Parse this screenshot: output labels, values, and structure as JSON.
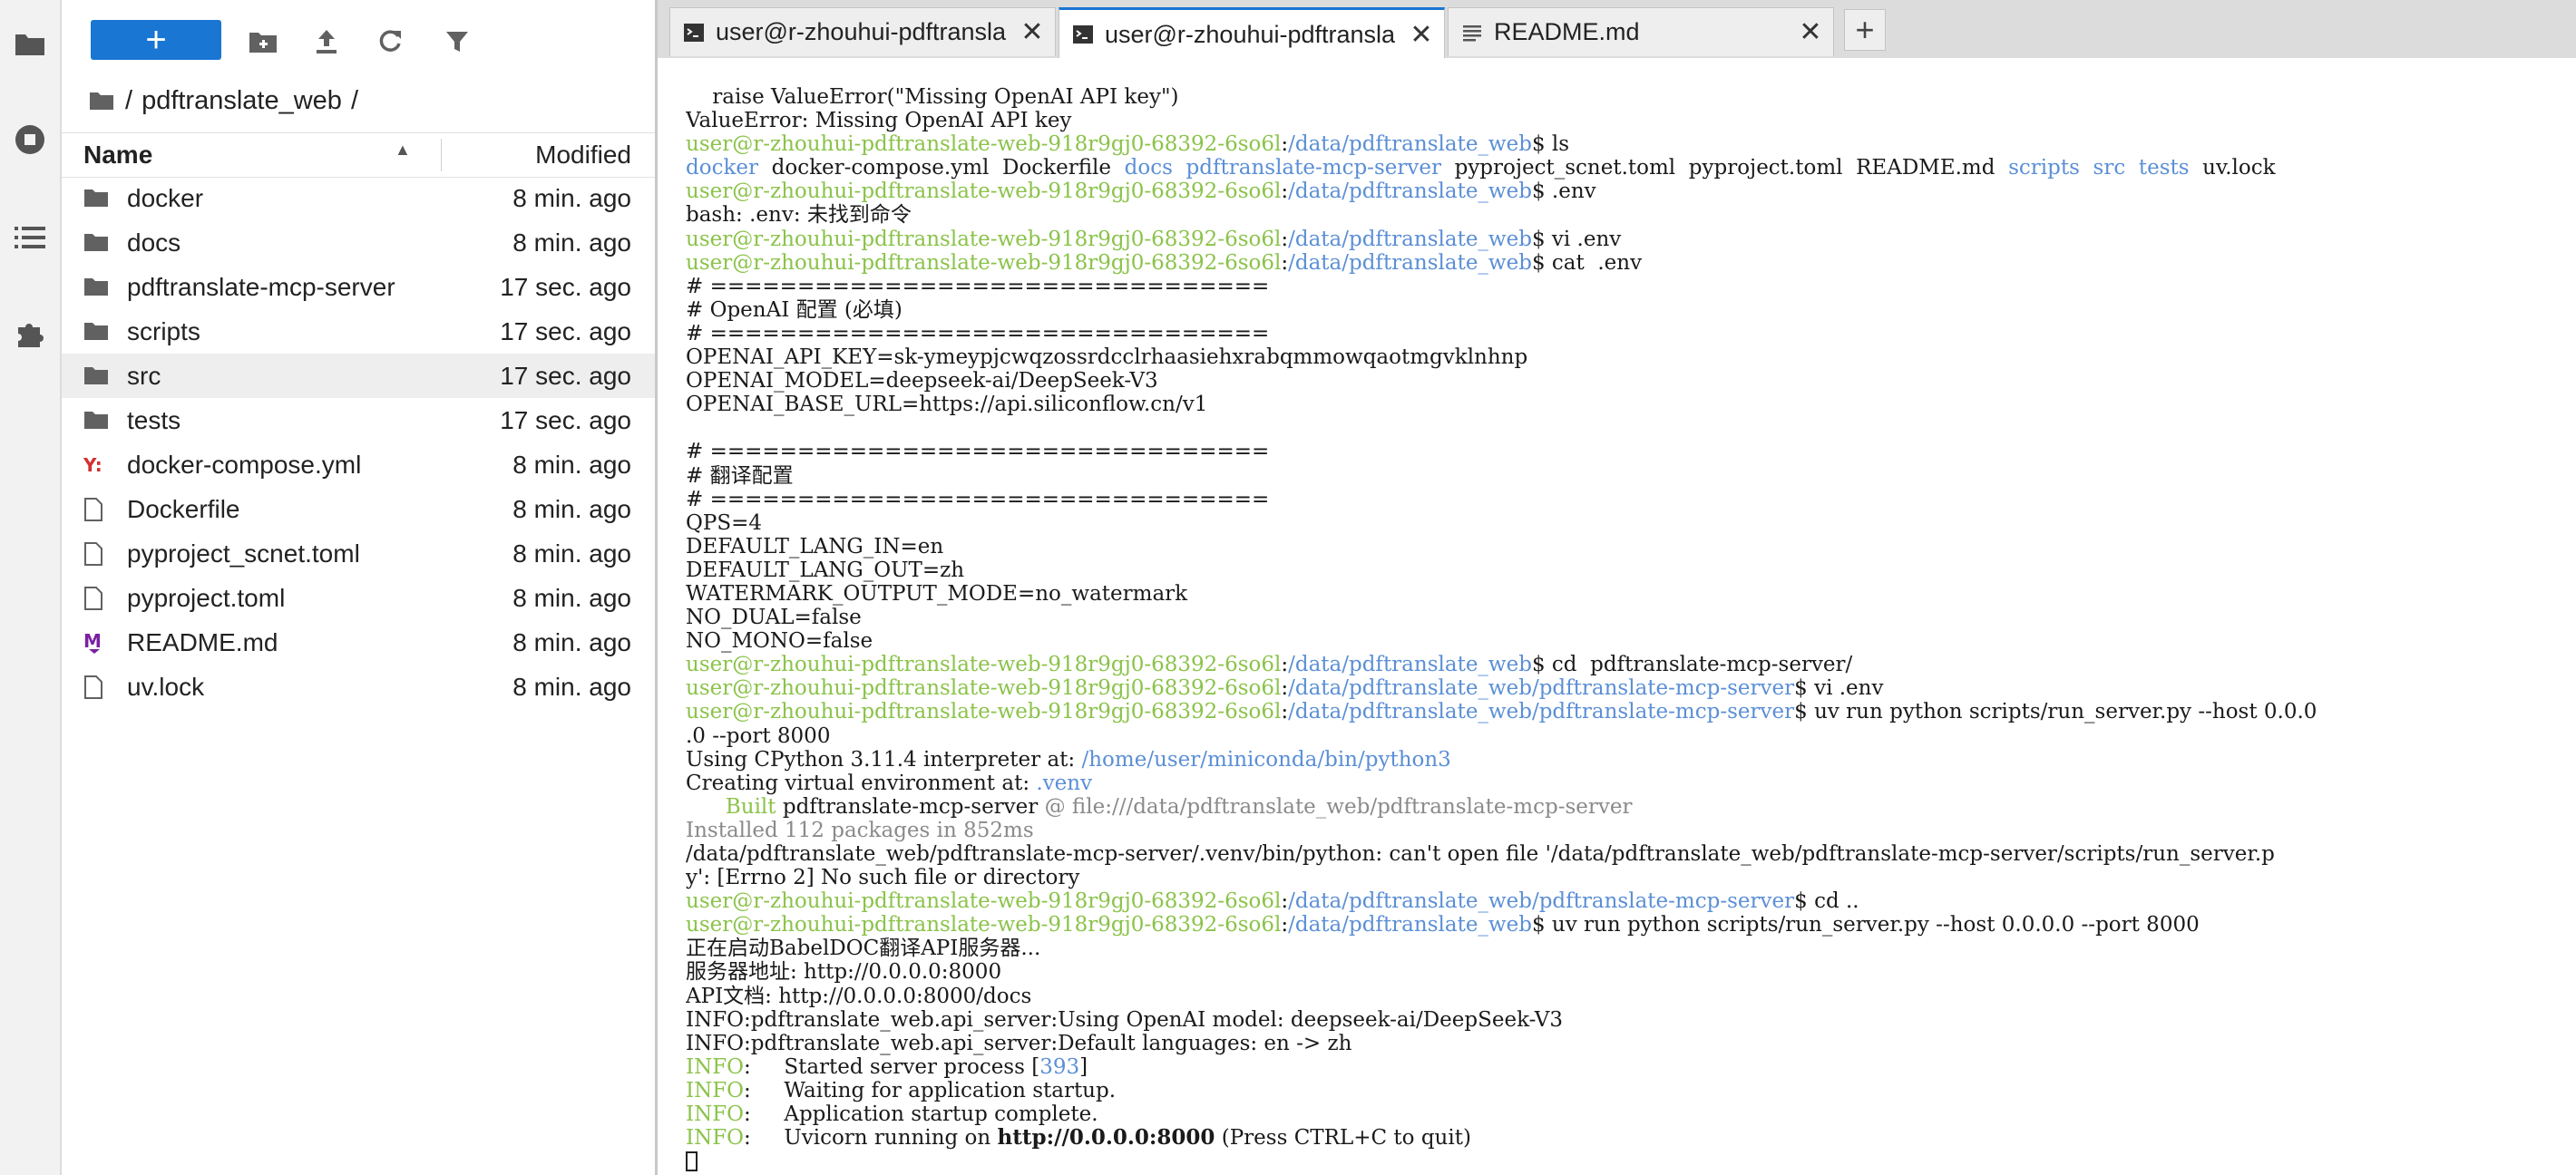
{
  "file_browser": {
    "breadcrumb": [
      "/",
      "pdftranslate_web",
      "/"
    ],
    "header": {
      "name": "Name",
      "modified": "Modified"
    },
    "files": [
      {
        "name": "docker",
        "modified": "8 min. ago",
        "kind": "folder",
        "icon": "folder-icon"
      },
      {
        "name": "docs",
        "modified": "8 min. ago",
        "kind": "folder",
        "icon": "folder-icon"
      },
      {
        "name": "pdftranslate-mcp-server",
        "modified": "17 sec. ago",
        "kind": "folder",
        "icon": "folder-icon"
      },
      {
        "name": "scripts",
        "modified": "17 sec. ago",
        "kind": "folder",
        "icon": "folder-icon"
      },
      {
        "name": "src",
        "modified": "17 sec. ago",
        "kind": "folder",
        "icon": "folder-icon",
        "selected": true
      },
      {
        "name": "tests",
        "modified": "17 sec. ago",
        "kind": "folder",
        "icon": "folder-icon"
      },
      {
        "name": "docker-compose.yml",
        "modified": "8 min. ago",
        "kind": "yaml",
        "icon": "yaml-file-icon"
      },
      {
        "name": "Dockerfile",
        "modified": "8 min. ago",
        "kind": "file",
        "icon": "file-icon"
      },
      {
        "name": "pyproject_scnet.toml",
        "modified": "8 min. ago",
        "kind": "file",
        "icon": "file-icon"
      },
      {
        "name": "pyproject.toml",
        "modified": "8 min. ago",
        "kind": "file",
        "icon": "file-icon"
      },
      {
        "name": "README.md",
        "modified": "8 min. ago",
        "kind": "markdown",
        "icon": "markdown-file-icon"
      },
      {
        "name": "uv.lock",
        "modified": "8 min. ago",
        "kind": "file",
        "icon": "file-icon"
      }
    ]
  },
  "tabs": [
    {
      "label": "user@r-zhouhui-pdftransla",
      "icon": "terminal-icon",
      "active": false
    },
    {
      "label": "user@r-zhouhui-pdftransla",
      "icon": "terminal-icon",
      "active": true
    },
    {
      "label": "README.md",
      "icon": "document-icon",
      "active": false
    }
  ],
  "colors": {
    "accent": "#1976d2",
    "prompt_user": "#8bc34a",
    "prompt_path": "#5b8fd6",
    "dim": "#8a8a8a"
  },
  "terminal": {
    "lines": [
      [
        [
          "    raise ValueError(\"Missing OpenAI API key\")"
        ]
      ],
      [
        [
          "ValueError: Missing OpenAI API key"
        ]
      ],
      [
        [
          "user@r-zhouhui-pdftranslate-web-918r9gj0-68392-6so6l",
          "g"
        ],
        [
          ":"
        ],
        [
          "/data/pdftranslate_web",
          "b"
        ],
        [
          "$ ls"
        ]
      ],
      [
        [
          "docker",
          "b"
        ],
        [
          "  docker-compose.yml  Dockerfile  "
        ],
        [
          "docs",
          "b"
        ],
        [
          "  "
        ],
        [
          "pdftranslate-mcp-server",
          "b"
        ],
        [
          "  pyproject_scnet.toml  pyproject.toml  README.md  "
        ],
        [
          "scripts",
          "b"
        ],
        [
          "  "
        ],
        [
          "src",
          "b"
        ],
        [
          "  "
        ],
        [
          "tests",
          "b"
        ],
        [
          "  uv.lock"
        ]
      ],
      [
        [
          "user@r-zhouhui-pdftranslate-web-918r9gj0-68392-6so6l",
          "g"
        ],
        [
          ":"
        ],
        [
          "/data/pdftranslate_web",
          "b"
        ],
        [
          "$ .env"
        ]
      ],
      [
        [
          "bash: .env: 未找到命令"
        ]
      ],
      [
        [
          "user@r-zhouhui-pdftranslate-web-918r9gj0-68392-6so6l",
          "g"
        ],
        [
          ":"
        ],
        [
          "/data/pdftranslate_web",
          "b"
        ],
        [
          "$ vi .env"
        ]
      ],
      [
        [
          "user@r-zhouhui-pdftranslate-web-918r9gj0-68392-6so6l",
          "g"
        ],
        [
          ":"
        ],
        [
          "/data/pdftranslate_web",
          "b"
        ],
        [
          "$ cat  .env"
        ]
      ],
      [
        [
          "# ================================"
        ]
      ],
      [
        [
          "# OpenAI 配置 (必填)"
        ]
      ],
      [
        [
          "# ================================"
        ]
      ],
      [
        [
          "OPENAI_API_KEY=sk-ymeypjcwqzossrdcclrhaasiehxrabqmmowqaotmgvklnhnp"
        ]
      ],
      [
        [
          "OPENAI_MODEL=deepseek-ai/DeepSeek-V3"
        ]
      ],
      [
        [
          "OPENAI_BASE_URL=https://api.siliconflow.cn/v1"
        ]
      ],
      [
        [
          ""
        ]
      ],
      [
        [
          "# ================================"
        ]
      ],
      [
        [
          "# 翻译配置"
        ]
      ],
      [
        [
          "# ================================"
        ]
      ],
      [
        [
          "QPS=4"
        ]
      ],
      [
        [
          "DEFAULT_LANG_IN=en"
        ]
      ],
      [
        [
          "DEFAULT_LANG_OUT=zh"
        ]
      ],
      [
        [
          "WATERMARK_OUTPUT_MODE=no_watermark"
        ]
      ],
      [
        [
          "NO_DUAL=false"
        ]
      ],
      [
        [
          "NO_MONO=false"
        ]
      ],
      [
        [
          "user@r-zhouhui-pdftranslate-web-918r9gj0-68392-6so6l",
          "g"
        ],
        [
          ":"
        ],
        [
          "/data/pdftranslate_web",
          "b"
        ],
        [
          "$ cd  pdftranslate-mcp-server/"
        ]
      ],
      [
        [
          "user@r-zhouhui-pdftranslate-web-918r9gj0-68392-6so6l",
          "g"
        ],
        [
          ":"
        ],
        [
          "/data/pdftranslate_web/pdftranslate-mcp-server",
          "b"
        ],
        [
          "$ vi .env"
        ]
      ],
      [
        [
          "user@r-zhouhui-pdftranslate-web-918r9gj0-68392-6so6l",
          "g"
        ],
        [
          ":"
        ],
        [
          "/data/pdftranslate_web/pdftranslate-mcp-server",
          "b"
        ],
        [
          "$ uv run python scripts/run_server.py --host 0.0.0"
        ]
      ],
      [
        [
          ".0 --port 8000"
        ]
      ],
      [
        [
          "Using CPython 3.11.4 interpreter at: "
        ],
        [
          "/home/user/miniconda/bin/python3",
          "b"
        ]
      ],
      [
        [
          "Creating virtual environment at: "
        ],
        [
          ".venv",
          "b"
        ]
      ],
      [
        [
          "      Built ",
          "g"
        ],
        [
          "pdftranslate-mcp-server"
        ],
        [
          " @ file:///data/pdftranslate_web/pdftranslate-mcp-server",
          "gr"
        ]
      ],
      [
        [
          "Installed 112 packages in 852ms",
          "gr"
        ]
      ],
      [
        [
          "/data/pdftranslate_web/pdftranslate-mcp-server/.venv/bin/python: can't open file '/data/pdftranslate_web/pdftranslate-mcp-server/scripts/run_server.p"
        ]
      ],
      [
        [
          "y': [Errno 2] No such file or directory"
        ]
      ],
      [
        [
          "user@r-zhouhui-pdftranslate-web-918r9gj0-68392-6so6l",
          "g"
        ],
        [
          ":"
        ],
        [
          "/data/pdftranslate_web/pdftranslate-mcp-server",
          "b"
        ],
        [
          "$ cd .."
        ]
      ],
      [
        [
          "user@r-zhouhui-pdftranslate-web-918r9gj0-68392-6so6l",
          "g"
        ],
        [
          ":"
        ],
        [
          "/data/pdftranslate_web",
          "b"
        ],
        [
          "$ uv run python scripts/run_server.py --host 0.0.0.0 --port 8000"
        ]
      ],
      [
        [
          "正在启动BabelDOC翻译API服务器..."
        ]
      ],
      [
        [
          "服务器地址: http://0.0.0.0:8000"
        ]
      ],
      [
        [
          "API文档: http://0.0.0.0:8000/docs"
        ]
      ],
      [
        [
          "INFO:pdftranslate_web.api_server:Using OpenAI model: deepseek-ai/DeepSeek-V3"
        ]
      ],
      [
        [
          "INFO:pdftranslate_web.api_server:Default languages: en -> zh"
        ]
      ],
      [
        [
          "INFO",
          "g"
        ],
        [
          ":     Started server process ["
        ],
        [
          "393",
          "b"
        ],
        [
          "]"
        ]
      ],
      [
        [
          "INFO",
          "g"
        ],
        [
          ":     Waiting for application startup."
        ]
      ],
      [
        [
          "INFO",
          "g"
        ],
        [
          ":     Application startup complete."
        ]
      ],
      [
        [
          "INFO",
          "g"
        ],
        [
          ":     Uvicorn running on "
        ],
        [
          "http://0.0.0.0:8000",
          "bold"
        ],
        [
          " (Press CTRL+C to quit)"
        ]
      ]
    ]
  }
}
